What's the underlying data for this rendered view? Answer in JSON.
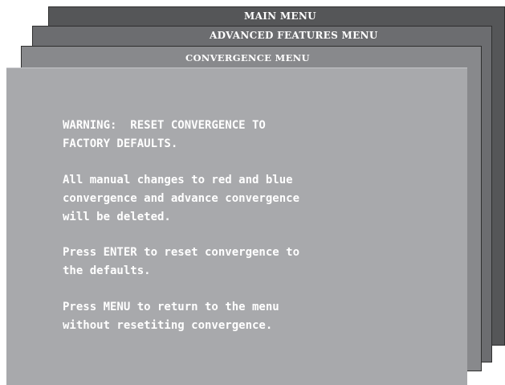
{
  "menus": {
    "main_title": "MAIN MENU",
    "advanced_title": "ADVANCED FEATURES MENU",
    "convergence_title": "CONVERGENCE MENU"
  },
  "message": {
    "warning": "WARNING:  RESET CONVERGENCE TO\nFACTORY DEFAULTS.",
    "changes": "All manual changes to red and blue\nconvergence and advance convergence\nwill be deleted.",
    "enter_instruction": "Press ENTER to reset convergence to\nthe defaults.",
    "menu_instruction": "Press MENU to return to the menu\nwithout resetiting convergence."
  },
  "colors": {
    "main_menu_bg": "#555658",
    "advanced_menu_bg": "#6c6d70",
    "convergence_menu_bg": "#88898c",
    "content_bg": "#a8a9ac",
    "text": "#ffffff"
  }
}
